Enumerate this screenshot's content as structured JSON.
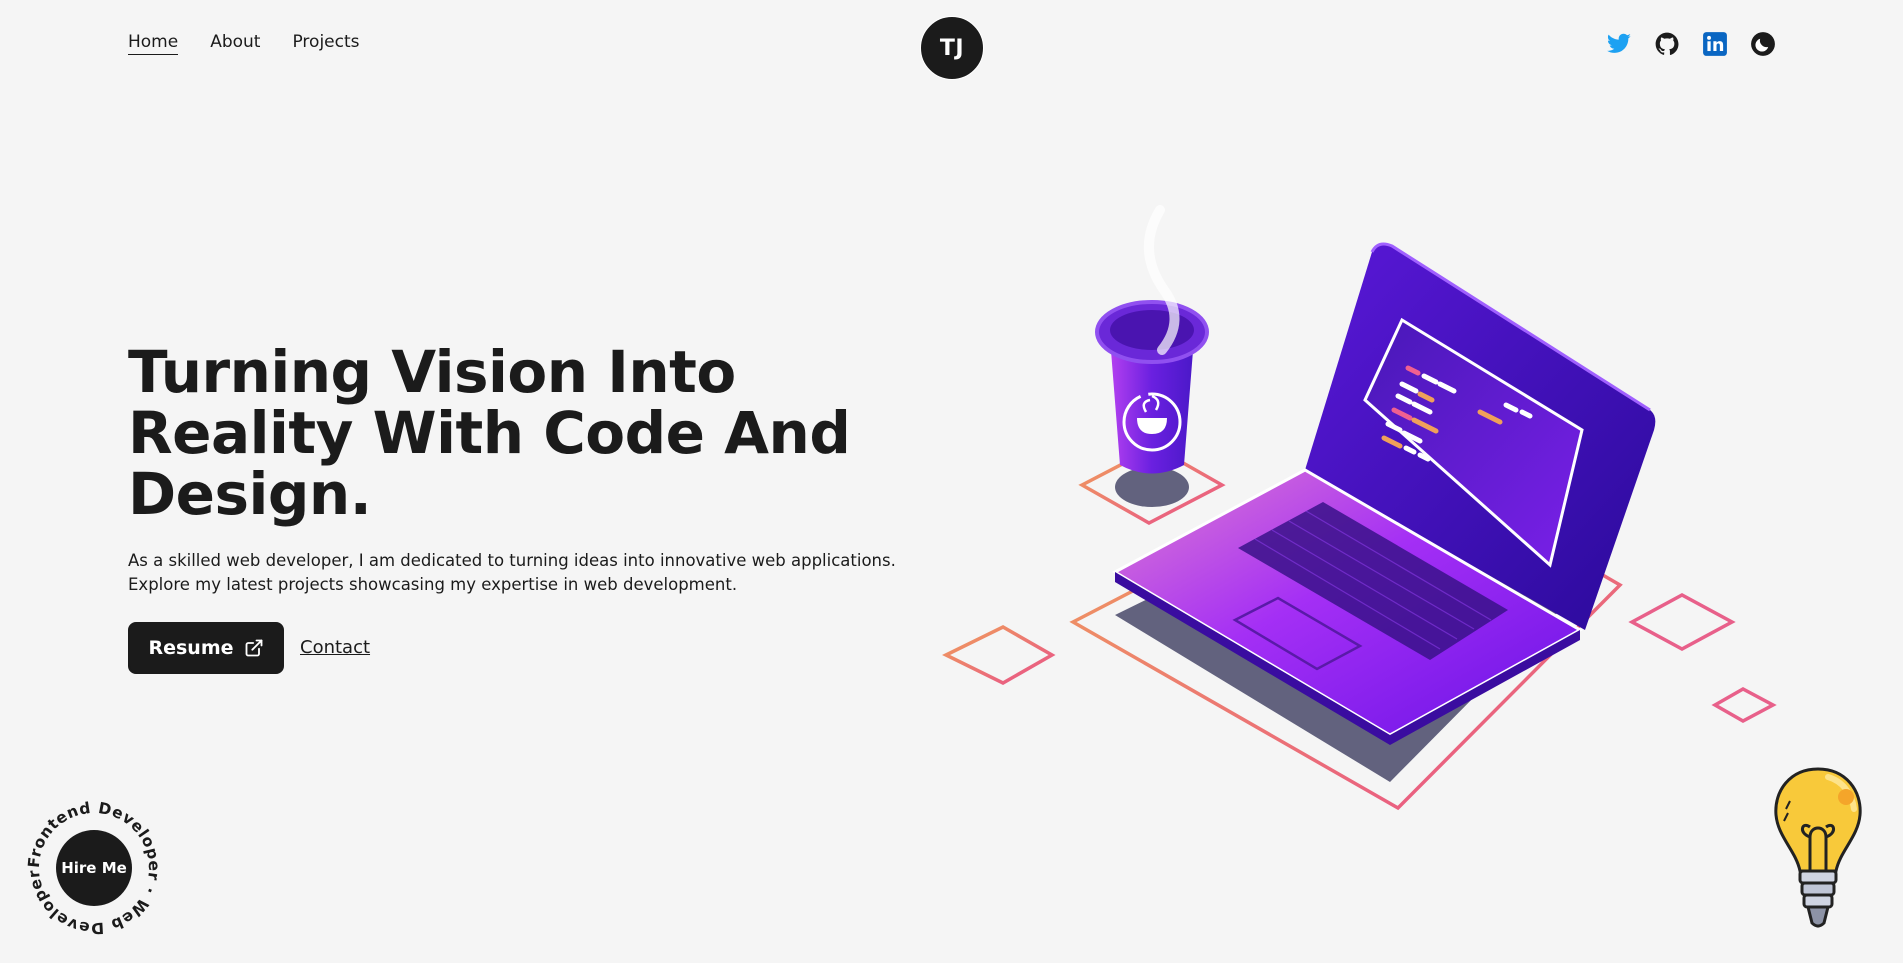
{
  "nav": {
    "items": [
      {
        "label": "Home",
        "active": true
      },
      {
        "label": "About",
        "active": false
      },
      {
        "label": "Projects",
        "active": false
      }
    ]
  },
  "logo": {
    "text": "TJ"
  },
  "social": {
    "icons": [
      "twitter-icon",
      "github-icon",
      "linkedin-icon",
      "theme-toggle-moon-icon"
    ],
    "colors": {
      "twitter": "#1da1f2",
      "github": "#1b1b1b",
      "linkedin": "#0a66c2",
      "theme": "#1b1b1b"
    }
  },
  "hero": {
    "title": "Turning Vision Into Reality With Code And Design.",
    "description": "As a skilled web developer, I am dedicated to turning ideas into innovative web applications. Explore my latest projects showcasing my expertise in web development.",
    "resume_label": "Resume",
    "contact_label": "Contact"
  },
  "hire": {
    "button_label": "Hire Me",
    "ring_text": "Frontend Developer · Web Developer ·"
  },
  "theme": {
    "background": "#f5f5f5",
    "dark": "#1b1b1b",
    "accent_purple": "#7c2ff0",
    "accent_pink": "#e85a8a",
    "accent_orange": "#f0a05a"
  }
}
